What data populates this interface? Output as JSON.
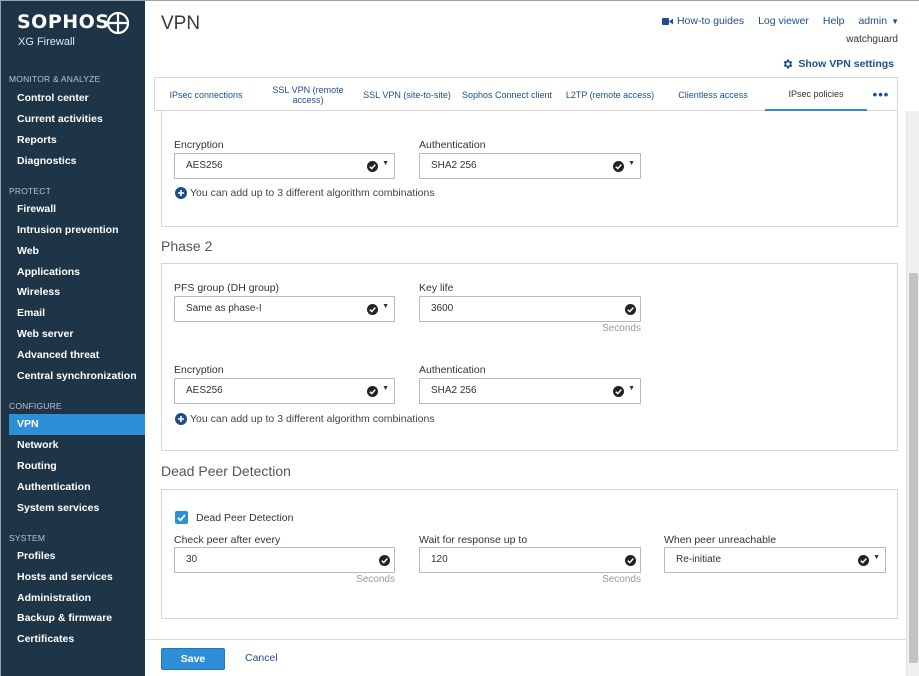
{
  "brand": {
    "name": "SOPHOS",
    "product": "XG Firewall"
  },
  "sidebar": {
    "sections": [
      {
        "title": "MONITOR & ANALYZE",
        "items": [
          "Control center",
          "Current activities",
          "Reports",
          "Diagnostics"
        ]
      },
      {
        "title": "PROTECT",
        "items": [
          "Firewall",
          "Intrusion prevention",
          "Web",
          "Applications",
          "Wireless",
          "Email",
          "Web server",
          "Advanced threat",
          "Central synchronization"
        ]
      },
      {
        "title": "CONFIGURE",
        "items": [
          "VPN",
          "Network",
          "Routing",
          "Authentication",
          "System services"
        ]
      },
      {
        "title": "SYSTEM",
        "items": [
          "Profiles",
          "Hosts and services",
          "Administration",
          "Backup & firmware",
          "Certificates"
        ]
      }
    ],
    "active": "VPN"
  },
  "header": {
    "title": "VPN",
    "links": {
      "howto": "How-to guides",
      "logviewer": "Log viewer",
      "help": "Help",
      "admin": "admin"
    },
    "username": "watchguard",
    "show_settings": "Show VPN settings"
  },
  "tabs": [
    "IPsec connections",
    "SSL VPN (remote access)",
    "SSL VPN (site-to-site)",
    "Sophos Connect client",
    "L2TP (remote access)",
    "Clientless access",
    "IPsec policies"
  ],
  "active_tab": "IPsec policies",
  "phase1": {
    "encryption_label": "Encryption",
    "encryption_value": "AES256",
    "authentication_label": "Authentication",
    "authentication_value": "SHA2 256",
    "add_note": "You can add up to 3 different algorithm combinations"
  },
  "phase2": {
    "title": "Phase 2",
    "pfs_label": "PFS group (DH group)",
    "pfs_value": "Same as phase-I",
    "keylife_label": "Key life",
    "keylife_value": "3600",
    "keylife_unit": "Seconds",
    "encryption_label": "Encryption",
    "encryption_value": "AES256",
    "authentication_label": "Authentication",
    "authentication_value": "SHA2 256",
    "add_note": "You can add up to 3 different algorithm combinations"
  },
  "dpd": {
    "title": "Dead Peer Detection",
    "checkbox_label": "Dead Peer Detection",
    "checked": true,
    "check_label": "Check peer after every",
    "check_value": "30",
    "check_unit": "Seconds",
    "wait_label": "Wait for response up to",
    "wait_value": "120",
    "wait_unit": "Seconds",
    "unreachable_label": "When peer unreachable",
    "unreachable_value": "Re-initiate"
  },
  "footer": {
    "save": "Save",
    "cancel": "Cancel"
  },
  "colors": {
    "sidebar_bg": "#1e3548",
    "accent": "#2f8fd6",
    "link": "#1f4e8c"
  }
}
